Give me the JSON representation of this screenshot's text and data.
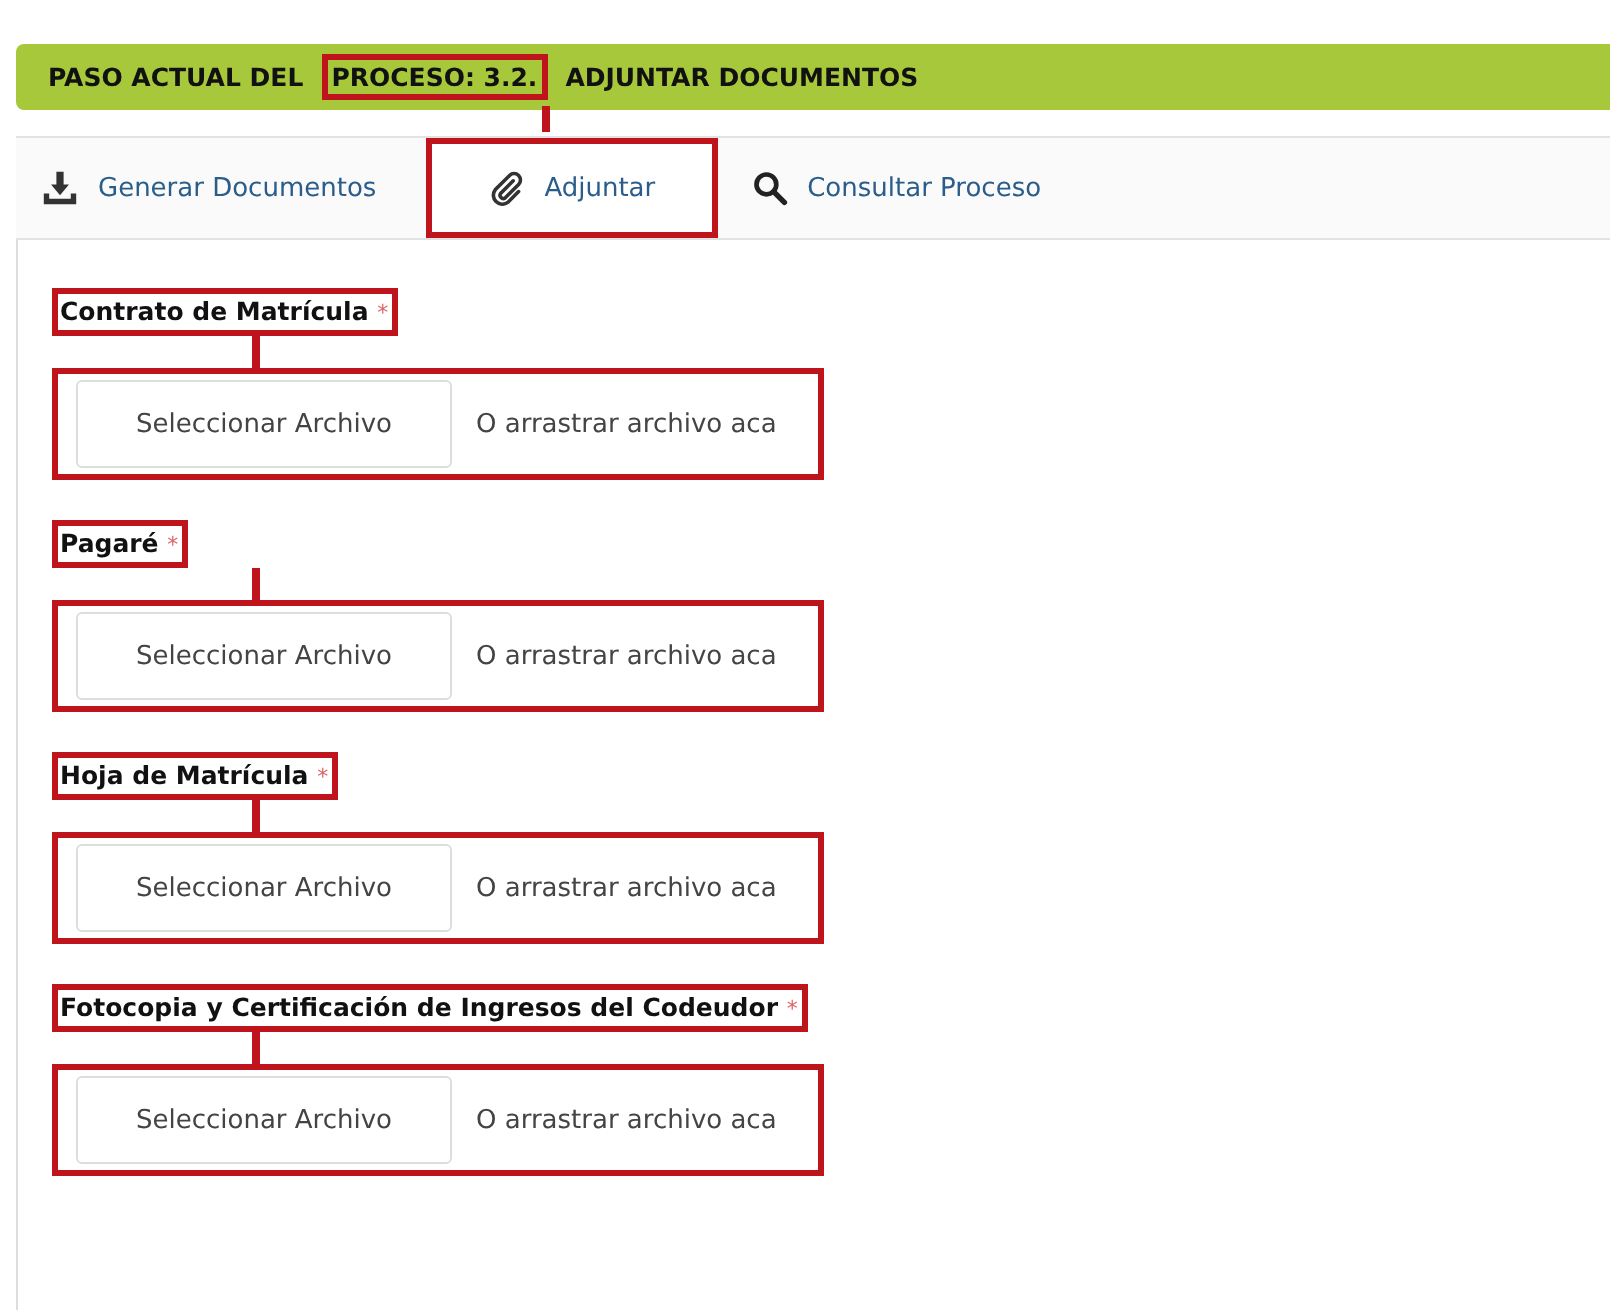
{
  "header": {
    "parts": [
      {
        "text": "PASO ACTUAL DEL",
        "annotated": false
      },
      {
        "text": "PROCESO: 3.2.",
        "annotated": true
      },
      {
        "text": "ADJUNTAR DOCUMENTOS",
        "annotated": false
      }
    ]
  },
  "tabs": [
    {
      "label": "Generar Documentos",
      "kind": "download",
      "selected": false,
      "annotated": false
    },
    {
      "label": "Adjuntar",
      "kind": "paperclip",
      "selected": true,
      "annotated": true
    },
    {
      "label": "Consultar Proceso",
      "kind": "search",
      "selected": false,
      "annotated": false
    }
  ],
  "fields": [
    {
      "label": "Contrato de Matrícula",
      "required": "*",
      "button": "Seleccionar Archivo",
      "hint": "O arrastrar archivo aca",
      "annotated": true
    },
    {
      "label": "Pagaré",
      "required": "*",
      "button": "Seleccionar Archivo",
      "hint": "O arrastrar archivo aca",
      "annotated": true
    },
    {
      "label": "Hoja de Matrícula",
      "required": "*",
      "button": "Seleccionar Archivo",
      "hint": "O arrastrar archivo aca",
      "annotated": true
    },
    {
      "label": "Fotocopia y Certificación de Ingresos del Codeudor",
      "required": "*",
      "button": "Seleccionar Archivo",
      "hint": "O arrastrar archivo aca",
      "annotated": true
    }
  ]
}
